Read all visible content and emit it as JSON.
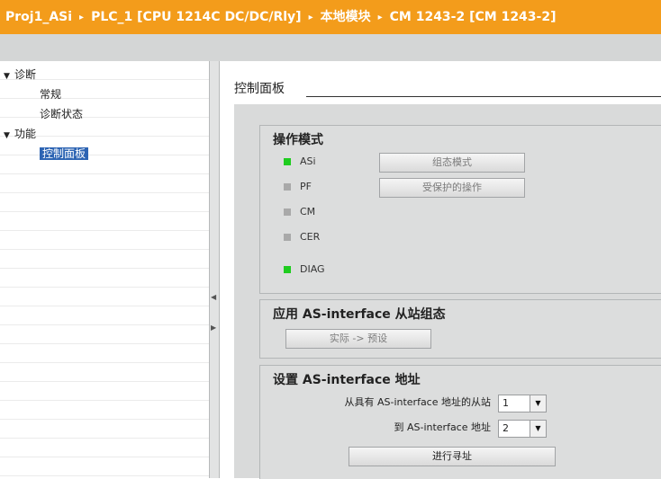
{
  "breadcrumb": [
    "Proj1_ASi",
    "PLC_1 [CPU 1214C DC/DC/Rly]",
    "本地模块",
    "CM 1243-2 [CM 1243-2]"
  ],
  "breadcrumb_separator": "▸",
  "tree": [
    {
      "label": "诊断",
      "expander": "▼"
    },
    {
      "label": "常规"
    },
    {
      "label": "诊断状态"
    },
    {
      "label": "功能",
      "expander": "▼"
    },
    {
      "label": "控制面板",
      "selected": true
    }
  ],
  "control_panel": {
    "title": "控制面板",
    "operating_mode": {
      "heading": "操作模式",
      "leds": [
        {
          "label": "ASi",
          "state": "on"
        },
        {
          "label": "PF",
          "state": "off"
        },
        {
          "label": "CM",
          "state": "off"
        },
        {
          "label": "CER",
          "state": "off"
        },
        {
          "label": "DIAG",
          "state": "on"
        }
      ],
      "config_mode_button": "组态模式",
      "protected_op_button": "受保护的操作"
    },
    "apply_config": {
      "heading": "应用 AS-interface 从站组态",
      "button": "实际 -> 预设"
    },
    "set_address": {
      "heading": "设置 AS-interface 地址",
      "from_label": "从具有 AS-interface 地址的从站",
      "from_value": "1",
      "to_label": "到 AS-interface 地址",
      "to_value": "2",
      "button": "进行寻址"
    }
  },
  "colors": {
    "title_bar": "#f39c1b",
    "led_on": "#1fcc1f",
    "led_off": "#a9a9a9",
    "selection": "#2d64b3"
  },
  "icons": {
    "expander": "triangle-down-icon",
    "dropdown": "chevron-down-icon",
    "splitter_left": "arrow-left-icon",
    "splitter_right": "arrow-right-icon"
  }
}
